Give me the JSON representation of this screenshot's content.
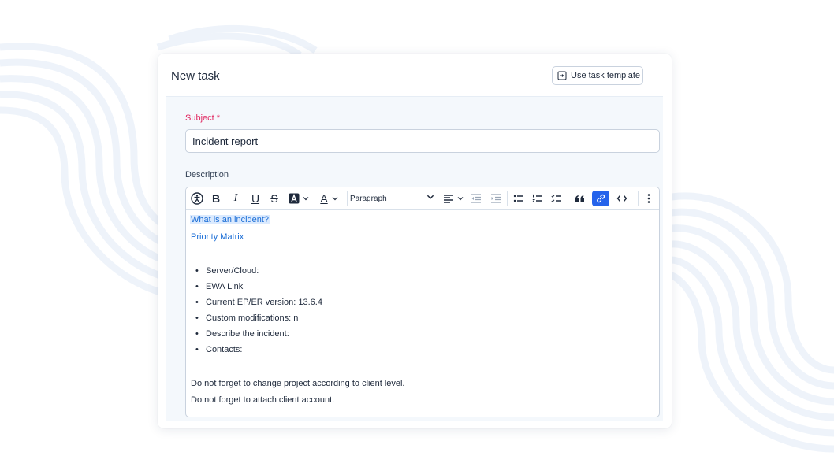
{
  "header": {
    "title": "New task",
    "template_button": "Use task template"
  },
  "subject": {
    "label": "Subject *",
    "value": "Incident report"
  },
  "description": {
    "label": "Description",
    "toolbar": {
      "bold": "B",
      "italic": "I",
      "underline": "U",
      "strike": "S",
      "text_color": "A",
      "paragraph": "Paragraph"
    },
    "links": [
      "What is an incident?",
      "Priority Matrix"
    ],
    "bullets": [
      "Server/Cloud:",
      "EWA Link",
      "Current EP/ER version: 13.6.4",
      "Custom modifications: n",
      "Describe the incident:",
      "Contacts:"
    ],
    "notes": [
      "Do not forget to change project according to client level.",
      "Do not forget to attach client account."
    ]
  },
  "colors": {
    "required": "#e0245e",
    "link": "#1a6dd6",
    "active_tool": "#2563eb",
    "form_bg": "#f4f8fc"
  },
  "icons": [
    "accessibility-icon",
    "highlight-icon",
    "align-left-icon",
    "outdent-icon",
    "indent-icon",
    "bullet-list-icon",
    "numbered-list-icon",
    "checklist-icon",
    "quote-icon",
    "link-icon",
    "code-icon",
    "more-icon",
    "template-icon"
  ]
}
